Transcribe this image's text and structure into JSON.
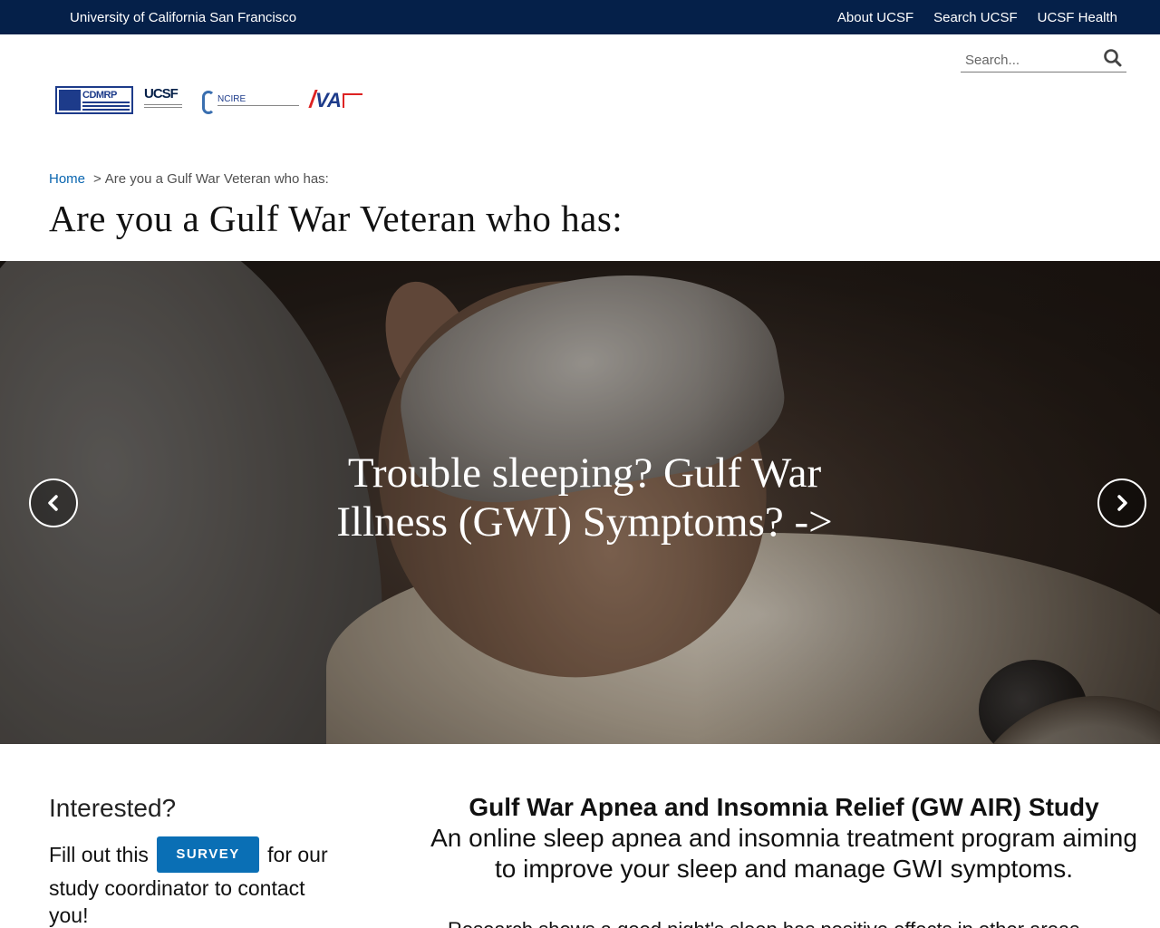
{
  "topbar": {
    "university": "University of California San Francisco",
    "links": [
      "About UCSF",
      "Search UCSF",
      "UCSF Health"
    ]
  },
  "search": {
    "placeholder": "Search...",
    "icon": "search-icon"
  },
  "logos": {
    "cdmrp": "CDMRP",
    "ucsf": "UCSF",
    "ncire": "NCIRE",
    "va": "VA"
  },
  "breadcrumb": {
    "home": "Home",
    "separator": ">",
    "current": "Are you a Gulf War Veteran who has:"
  },
  "page_title": "Are you a Gulf War Veteran who has:",
  "hero": {
    "caption": "Trouble sleeping? Gulf War Illness (GWI) Symptoms? ->",
    "prev_icon": "chevron-left-icon",
    "next_icon": "chevron-right-icon"
  },
  "sidebar": {
    "heading": "Interested?",
    "text_before": "Fill out this",
    "button": "SURVEY",
    "text_after": "for our study coordinator to contact you!"
  },
  "study": {
    "title": "Gulf War Apnea and Insomnia Relief (GW AIR) Study",
    "description": "An online sleep apnea and insomnia treatment program aiming to improve your sleep and manage GWI symptoms.",
    "research": "Research shows a good night's sleep has positive effects in other areas"
  },
  "colors": {
    "topbar": "#052049",
    "link": "#0a66b0",
    "button": "#0a6fb5"
  }
}
